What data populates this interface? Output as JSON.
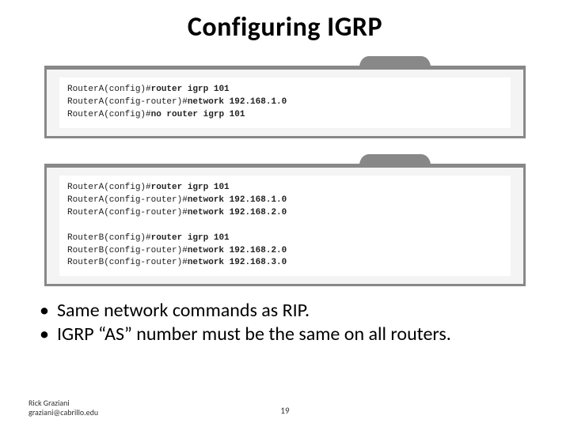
{
  "title": "Configuring IGRP",
  "terminals": [
    {
      "lines": [
        {
          "prompt": "RouterA(config)#",
          "cmd": "router igrp 101"
        },
        {
          "prompt": "RouterA(config-router)#",
          "cmd": "network 192.168.1.0"
        },
        {
          "prompt": "RouterA(config)#",
          "cmd": "no router igrp 101"
        }
      ]
    },
    {
      "lines": [
        {
          "prompt": "RouterA(config)#",
          "cmd": "router igrp 101"
        },
        {
          "prompt": "RouterA(config-router)#",
          "cmd": "network 192.168.1.0"
        },
        {
          "prompt": "RouterA(config-router)#",
          "cmd": "network 192.168.2.0"
        },
        {
          "prompt": "",
          "cmd": ""
        },
        {
          "prompt": "RouterB(config)#",
          "cmd": "router igrp 101"
        },
        {
          "prompt": "RouterB(config-router)#",
          "cmd": "network 192.168.2.0"
        },
        {
          "prompt": "RouterB(config-router)#",
          "cmd": "network 192.168.3.0"
        }
      ]
    }
  ],
  "bullets": [
    "Same network commands as RIP.",
    "IGRP “AS” number must be the same on all routers."
  ],
  "footer": {
    "author": "Rick Graziani",
    "email": "graziani@cabrillo.edu",
    "page": "19"
  }
}
